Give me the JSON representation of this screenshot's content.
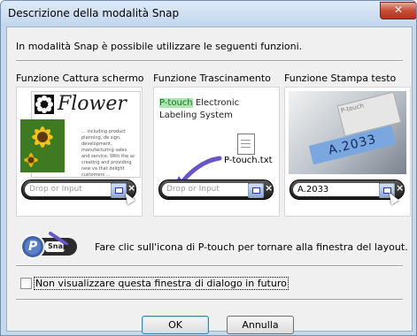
{
  "window": {
    "title": "Descrizione della modalità Snap",
    "close_glyph": "✕"
  },
  "intro": "In modalità Snap è possibile utilizzare le seguenti funzioni.",
  "columns": [
    {
      "label": "Funzione Cattura schermo"
    },
    {
      "label": "Funzione Trascinamento"
    },
    {
      "label": "Funzione Stampa testo"
    }
  ],
  "capture_panel": {
    "flower_word": "Flower",
    "doc_text": "... including product planning, de sign, development, manufacturing sales and service. With the ac creating and providing new va that delight customers ...",
    "drop_placeholder": "Drop or Input",
    "flower_icon": "gear-flower-icon"
  },
  "drag_panel": {
    "highlight": "P-touch",
    "line1_rest": " Electronic",
    "line2": "Labeling System",
    "file_name": "P-touch.txt",
    "drop_placeholder": "Drop or Input"
  },
  "print_panel": {
    "tape_text": "A.2033",
    "logo_text": "P-touch",
    "input_value": "A.2033"
  },
  "footer": {
    "icon_label": "Snap",
    "icon_letter": "P",
    "description": "Fare clic sull'icona di P-touch per tornare alla finestra del layout."
  },
  "checkbox": {
    "label": "Non visualizzare questa finestra di dialogo in futuro",
    "checked": false
  },
  "buttons": {
    "ok": "OK",
    "cancel": "Annulla"
  },
  "colors": {
    "highlight_green": "#a9e6b0",
    "arrow_purple": "#6b54c6",
    "title_bar": "#c7d9ee"
  }
}
